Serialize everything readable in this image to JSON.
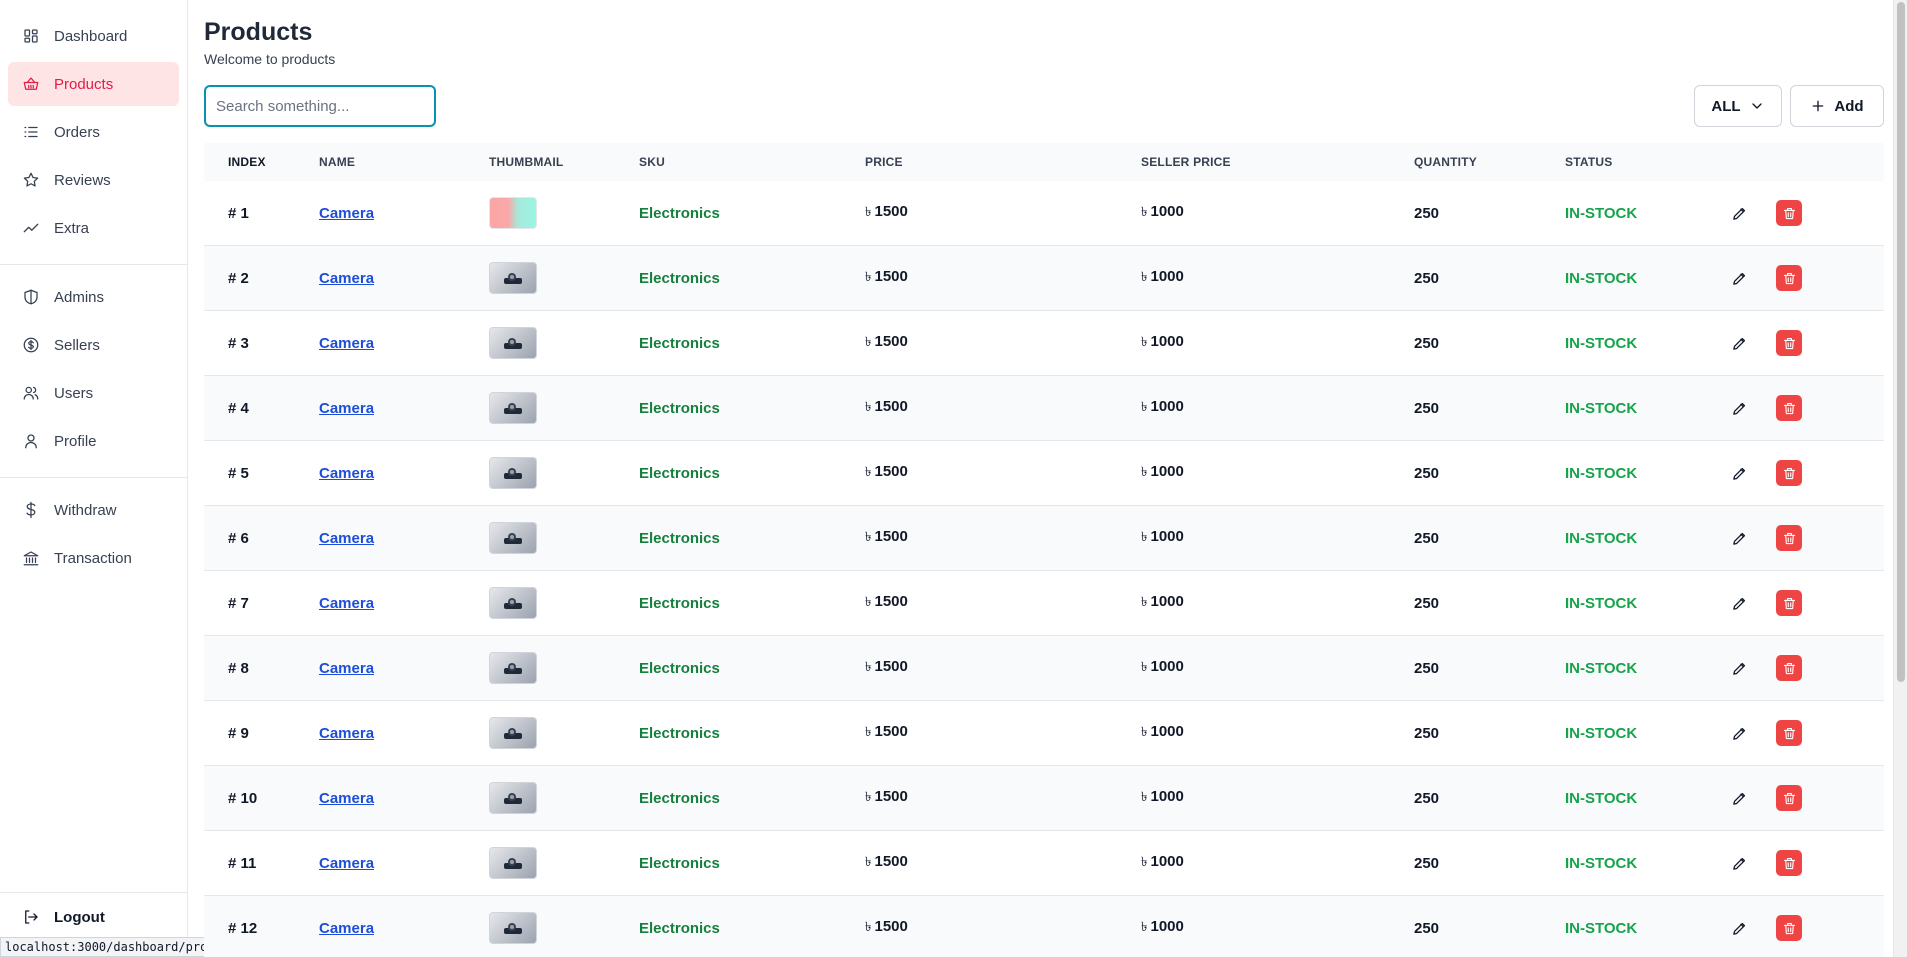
{
  "sidebar": {
    "group1": [
      {
        "label": "Dashboard",
        "icon": "dashboard-icon",
        "active": false
      },
      {
        "label": "Products",
        "icon": "basket-icon",
        "active": true
      },
      {
        "label": "Orders",
        "icon": "list-icon",
        "active": false
      },
      {
        "label": "Reviews",
        "icon": "star-icon",
        "active": false
      },
      {
        "label": "Extra",
        "icon": "trend-icon",
        "active": false
      }
    ],
    "group2": [
      {
        "label": "Admins",
        "icon": "shield-icon"
      },
      {
        "label": "Sellers",
        "icon": "dollar-circle-icon"
      },
      {
        "label": "Users",
        "icon": "users-icon"
      },
      {
        "label": "Profile",
        "icon": "user-icon"
      }
    ],
    "group3": [
      {
        "label": "Withdraw",
        "icon": "dollar-icon"
      },
      {
        "label": "Transaction",
        "icon": "bank-icon"
      }
    ],
    "logout": "Logout"
  },
  "status_url": "localhost:3000/dashboard/product",
  "header": {
    "title": "Products",
    "subtitle": "Welcome to products"
  },
  "toolbar": {
    "search_placeholder": "Search something...",
    "filter_label": "ALL",
    "add_label": "Add"
  },
  "table": {
    "columns": [
      "INDEX",
      "NAME",
      "THUMBMAIL",
      "SKU",
      "PRICE",
      "SELLER PRICE",
      "QUANTITY",
      "STATUS"
    ],
    "currency": "৳",
    "rows": [
      {
        "index": "# 1",
        "name": "Camera",
        "sku": "Electronics",
        "price": "1500",
        "seller_price": "1000",
        "quantity": "250",
        "status": "IN-STOCK"
      },
      {
        "index": "# 2",
        "name": "Camera",
        "sku": "Electronics",
        "price": "1500",
        "seller_price": "1000",
        "quantity": "250",
        "status": "IN-STOCK"
      },
      {
        "index": "# 3",
        "name": "Camera",
        "sku": "Electronics",
        "price": "1500",
        "seller_price": "1000",
        "quantity": "250",
        "status": "IN-STOCK"
      },
      {
        "index": "# 4",
        "name": "Camera",
        "sku": "Electronics",
        "price": "1500",
        "seller_price": "1000",
        "quantity": "250",
        "status": "IN-STOCK"
      },
      {
        "index": "# 5",
        "name": "Camera",
        "sku": "Electronics",
        "price": "1500",
        "seller_price": "1000",
        "quantity": "250",
        "status": "IN-STOCK"
      },
      {
        "index": "# 6",
        "name": "Camera",
        "sku": "Electronics",
        "price": "1500",
        "seller_price": "1000",
        "quantity": "250",
        "status": "IN-STOCK"
      },
      {
        "index": "# 7",
        "name": "Camera",
        "sku": "Electronics",
        "price": "1500",
        "seller_price": "1000",
        "quantity": "250",
        "status": "IN-STOCK"
      },
      {
        "index": "# 8",
        "name": "Camera",
        "sku": "Electronics",
        "price": "1500",
        "seller_price": "1000",
        "quantity": "250",
        "status": "IN-STOCK"
      },
      {
        "index": "# 9",
        "name": "Camera",
        "sku": "Electronics",
        "price": "1500",
        "seller_price": "1000",
        "quantity": "250",
        "status": "IN-STOCK"
      },
      {
        "index": "# 10",
        "name": "Camera",
        "sku": "Electronics",
        "price": "1500",
        "seller_price": "1000",
        "quantity": "250",
        "status": "IN-STOCK"
      },
      {
        "index": "# 11",
        "name": "Camera",
        "sku": "Electronics",
        "price": "1500",
        "seller_price": "1000",
        "quantity": "250",
        "status": "IN-STOCK"
      },
      {
        "index": "# 12",
        "name": "Camera",
        "sku": "Electronics",
        "price": "1500",
        "seller_price": "1000",
        "quantity": "250",
        "status": "IN-STOCK"
      }
    ]
  },
  "colors": {
    "active_nav_bg": "#ffe4e6",
    "active_nav_text": "#e11d48",
    "sku_green": "#15803d",
    "status_green": "#16a34a",
    "delete_red": "#ef4444",
    "link_blue": "#1d4ed8",
    "search_focus": "#0891b2"
  }
}
